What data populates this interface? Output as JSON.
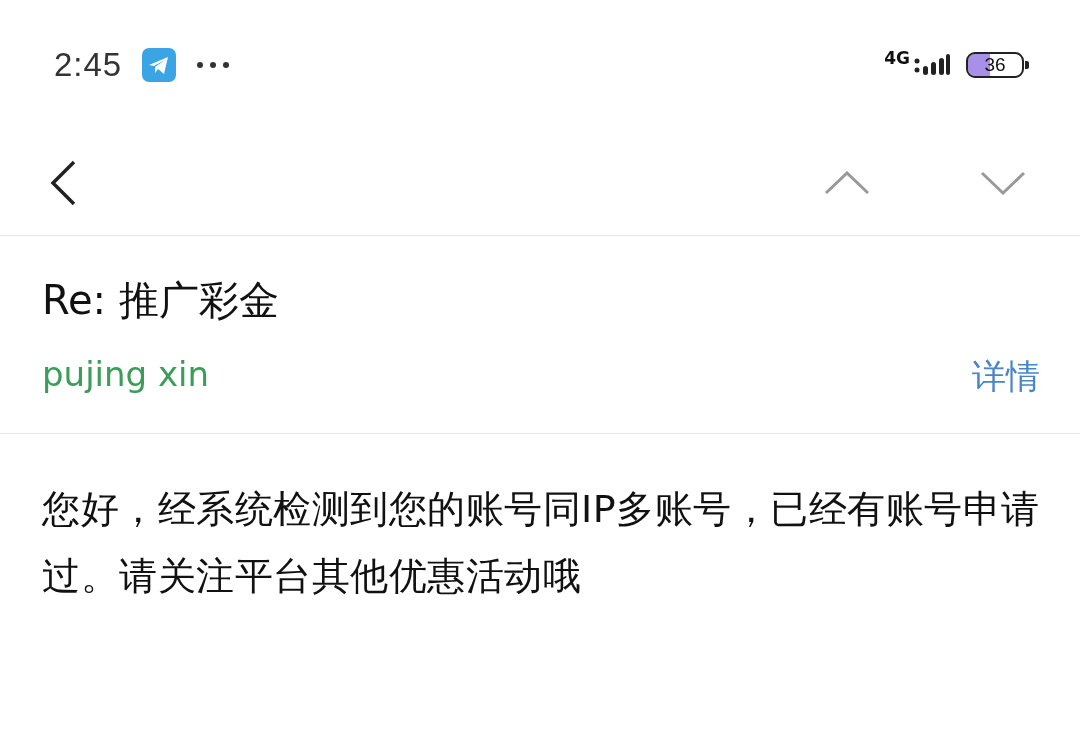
{
  "status_bar": {
    "time": "2:45",
    "network": "4G",
    "battery": "36"
  },
  "message": {
    "subject": "Re: 推广彩金",
    "sender": "pujing xin",
    "details_link": "详情",
    "body": "您好，经系统检测到您的账号同IP多账号，已经有账号申请过。请关注平台其他优惠活动哦"
  }
}
